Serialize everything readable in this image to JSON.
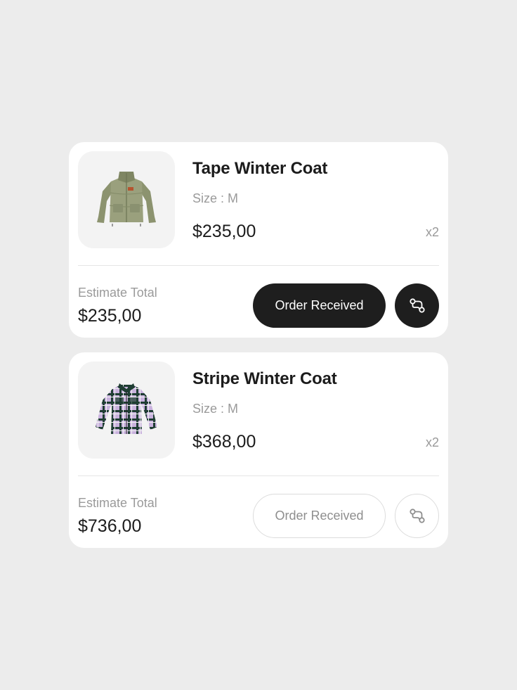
{
  "orders": [
    {
      "product_name": "Tape Winter Coat",
      "size_label": "Size  : M",
      "price": "$235,00",
      "quantity": "x2",
      "estimate_label": "Estimate Total",
      "estimate_total": "$235,00",
      "action_label": "Order Received",
      "action_style": "filled",
      "product_image": "olive-puffer-jacket"
    },
    {
      "product_name": "Stripe Winter Coat",
      "size_label": "Size  : M",
      "price": "$368,00",
      "quantity": "x2",
      "estimate_label": "Estimate Total",
      "estimate_total": "$736,00",
      "action_label": "Order Received",
      "action_style": "outline",
      "product_image": "lilac-plaid-jacket"
    }
  ],
  "colors": {
    "background": "#ececec",
    "card": "#ffffff",
    "filled_button": "#1e1e1e",
    "muted_text": "#9a9a9a",
    "primary_text": "#1c1c1c"
  },
  "icons": {
    "track_icon": "route-track-icon"
  }
}
